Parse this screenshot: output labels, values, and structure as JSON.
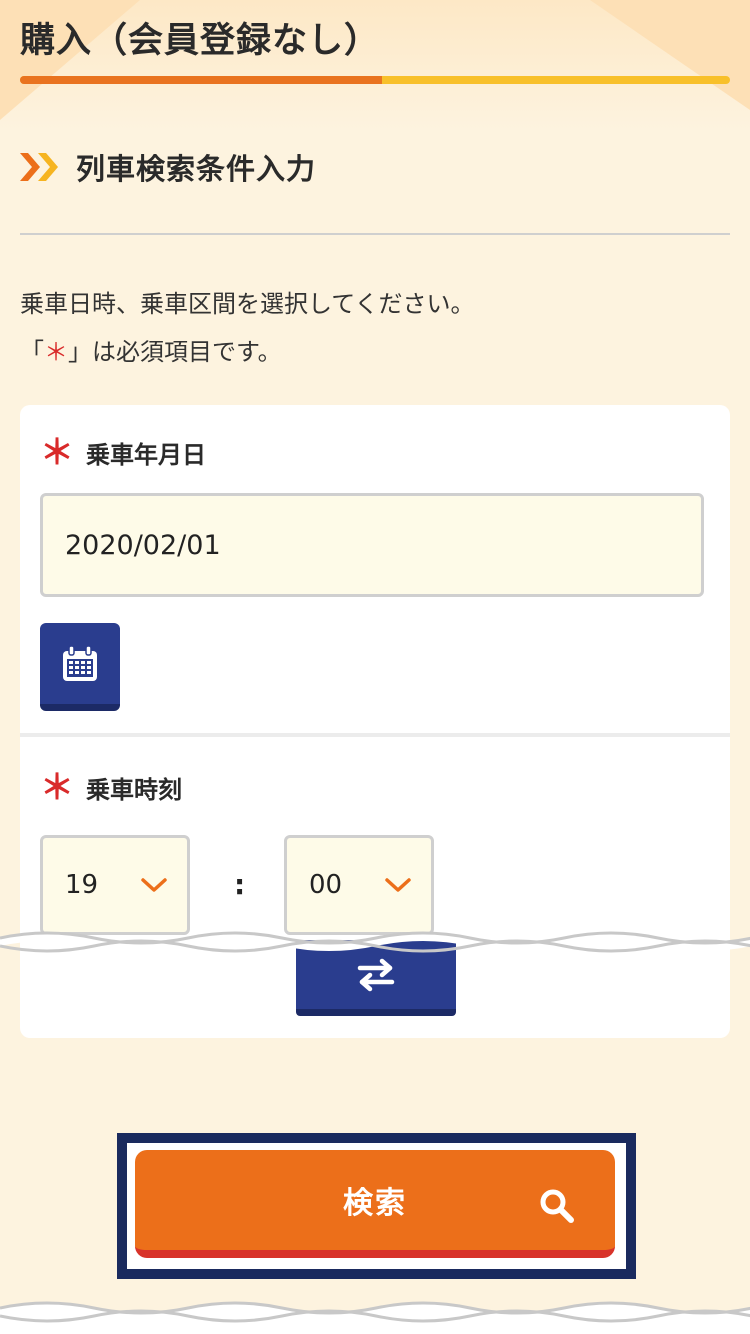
{
  "header": {
    "title": "購入（会員登録なし）",
    "progress_percent": 51
  },
  "section": {
    "title": "列車検索条件入力"
  },
  "intro": {
    "line1": "乗車日時、乗車区間を選択してください。",
    "line2_open": "「",
    "line2_star": "＊",
    "line2_close": "」は必須項目です。"
  },
  "date_field": {
    "required_mark": "＊",
    "label": "乗車年月日",
    "value": "2020/02/01",
    "calendar_icon": "calendar-icon"
  },
  "time_field": {
    "required_mark": "＊",
    "label": "乗車時刻",
    "hour": "19",
    "separator": ":",
    "minute": "00",
    "dropdown_icon": "chevron-down-icon"
  },
  "swap": {
    "icon": "swap-arrows-icon"
  },
  "search": {
    "label": "検索",
    "icon": "search-icon"
  },
  "colors": {
    "accent_orange": "#ec6f1a",
    "progress_orange": "#e9731f",
    "progress_yellow": "#f8c02a",
    "navy": "#2a3d8e",
    "required_red": "#d92a2a",
    "background": "#fdf3df"
  }
}
